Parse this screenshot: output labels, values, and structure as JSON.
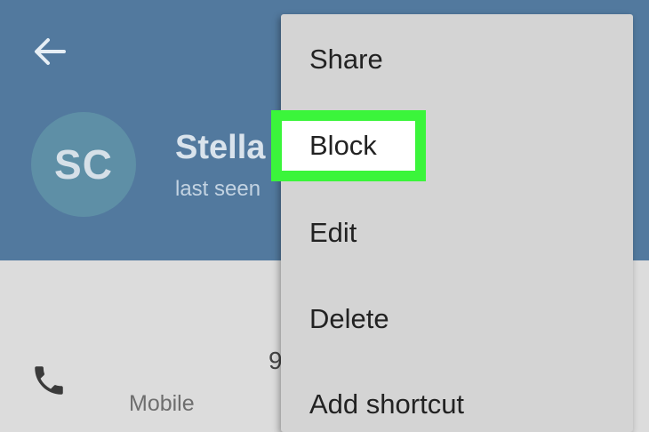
{
  "header": {
    "avatar_initials": "SC",
    "contact_name": "Stella",
    "status": "last seen"
  },
  "contact_info": {
    "phone_number_partial": "9",
    "phone_label": "Mobile"
  },
  "menu": {
    "items": [
      {
        "label": "Share"
      },
      {
        "label": "Block",
        "highlighted": true
      },
      {
        "label": "Edit"
      },
      {
        "label": "Delete"
      },
      {
        "label": "Add shortcut"
      }
    ]
  },
  "icons": {
    "back": "back-arrow-icon",
    "phone": "phone-icon"
  },
  "colors": {
    "header_bg": "#52799e",
    "avatar_bg": "#5e8fa6",
    "menu_bg": "#d4d4d4",
    "highlight": "#3bf53b"
  }
}
